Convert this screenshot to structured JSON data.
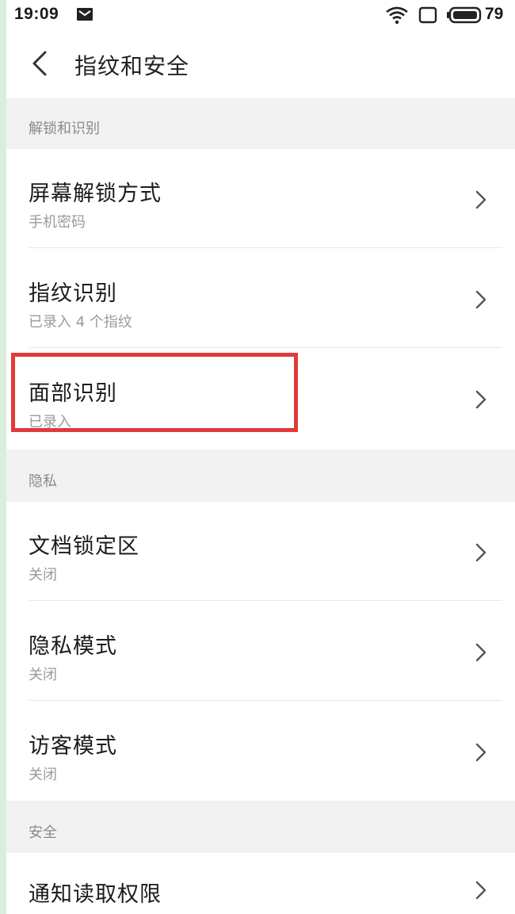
{
  "status_bar": {
    "time": "19:09",
    "battery_level": "79",
    "icons": [
      "message-icon",
      "wifi-icon",
      "screen-icon",
      "battery-icon"
    ]
  },
  "header": {
    "title": "指纹和安全",
    "back_icon": "chevron-left-icon"
  },
  "sections": [
    {
      "header": "解锁和识别",
      "items": [
        {
          "title": "屏幕解锁方式",
          "subtitle": "手机密码"
        },
        {
          "title": "指纹识别",
          "subtitle": "已录入 4 个指纹"
        },
        {
          "title": "面部识别",
          "subtitle": "已录入"
        }
      ]
    },
    {
      "header": "隐私",
      "items": [
        {
          "title": "文档锁定区",
          "subtitle": "关闭"
        },
        {
          "title": "隐私模式",
          "subtitle": "关闭"
        },
        {
          "title": "访客模式",
          "subtitle": "关闭"
        }
      ]
    },
    {
      "header": "安全",
      "items": [
        {
          "title": "通知读取权限",
          "subtitle": ""
        }
      ]
    }
  ],
  "colors": {
    "highlight_border": "#e03a3a",
    "section_background": "#f2f2f2",
    "left_edge": "#d9eedb"
  }
}
